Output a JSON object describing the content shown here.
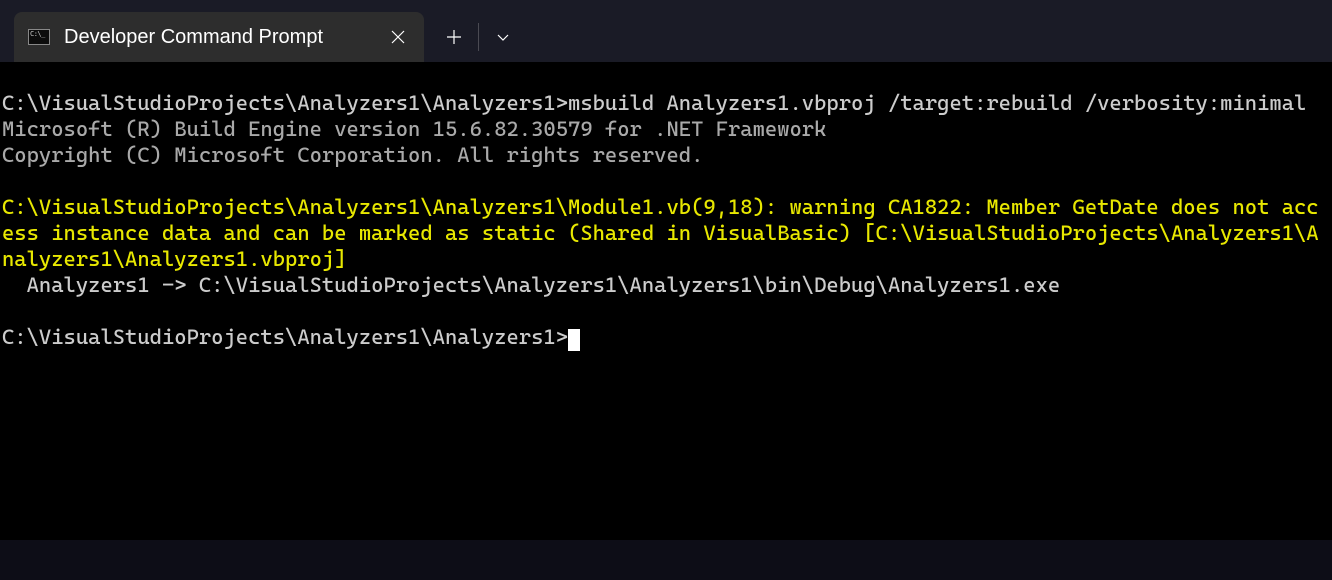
{
  "tab": {
    "title": "Developer Command Prompt"
  },
  "terminal": {
    "prompt1": "C:\\VisualStudioProjects\\Analyzers1\\Analyzers1>",
    "command1": "msbuild Analyzers1.vbproj /target:rebuild /verbosity:minimal",
    "engine_line": "Microsoft (R) Build Engine version 15.6.82.30579 for .NET Framework",
    "copyright_line": "Copyright (C) Microsoft Corporation. All rights reserved.",
    "warning": "C:\\VisualStudioProjects\\Analyzers1\\Analyzers1\\Module1.vb(9,18): warning CA1822: Member GetDate does not access instance data and can be marked as static (Shared in VisualBasic) [C:\\VisualStudioProjects\\Analyzers1\\Analyzers1\\Analyzers1.vbproj]",
    "output_line": "  Analyzers1 -> C:\\VisualStudioProjects\\Analyzers1\\Analyzers1\\bin\\Debug\\Analyzers1.exe",
    "prompt2": "C:\\VisualStudioProjects\\Analyzers1\\Analyzers1>"
  }
}
